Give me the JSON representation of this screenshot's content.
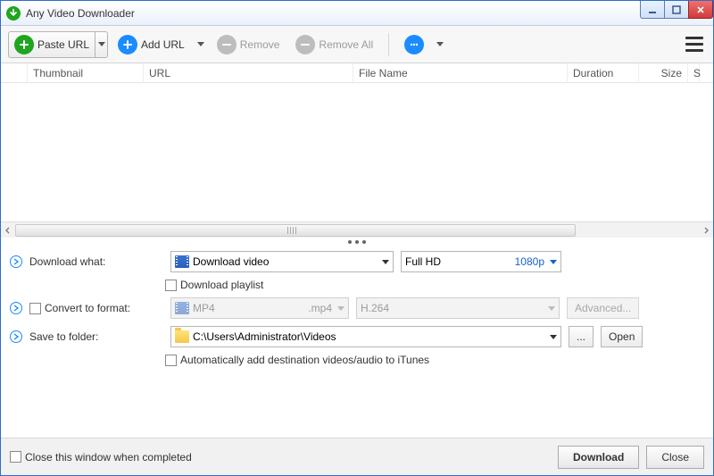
{
  "window": {
    "title": "Any Video Downloader"
  },
  "toolbar": {
    "paste_url": "Paste URL",
    "add_url": "Add URL",
    "remove": "Remove",
    "remove_all": "Remove All"
  },
  "columns": {
    "thumbnail": "Thumbnail",
    "url": "URL",
    "filename": "File Name",
    "duration": "Duration",
    "size": "Size",
    "s": "S"
  },
  "download_what": {
    "label": "Download what:",
    "value": "Download video",
    "quality_label": "Full HD",
    "quality_value": "1080p",
    "playlist": "Download playlist"
  },
  "convert": {
    "label": "Convert to format:",
    "format": "MP4",
    "ext": ".mp4",
    "codec": "H.264",
    "advanced": "Advanced..."
  },
  "save": {
    "label": "Save to folder:",
    "path": "C:\\Users\\Administrator\\Videos",
    "browse": "...",
    "open": "Open",
    "itunes": "Automatically add destination videos/audio to iTunes"
  },
  "footer": {
    "close_when_done": "Close this window when completed",
    "download": "Download",
    "close": "Close"
  }
}
